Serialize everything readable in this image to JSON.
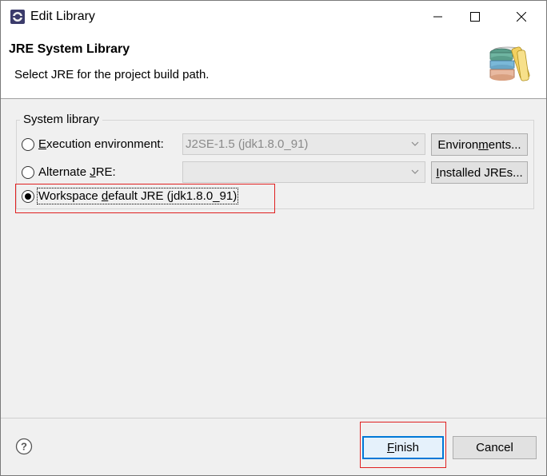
{
  "window": {
    "title": "Edit Library"
  },
  "banner": {
    "title": "JRE System Library",
    "subtitle": "Select JRE for the project build path.",
    "icon": "library-books-icon"
  },
  "group": {
    "label": "System library",
    "execution_env": {
      "label_pre": "",
      "label_mnemonic": "E",
      "label_post": "xecution environment:",
      "selected": false,
      "combo_value": "J2SE-1.5 (jdk1.8.0_91)",
      "button_label_pre": "Environ",
      "button_label_mnemonic": "m",
      "button_label_post": "ents..."
    },
    "alternate_jre": {
      "label_pre": "Alternate ",
      "label_mnemonic": "J",
      "label_post": "RE:",
      "selected": false,
      "combo_value": "",
      "button_label_pre": "",
      "button_label_mnemonic": "I",
      "button_label_post": "nstalled JREs..."
    },
    "workspace_default": {
      "label_pre": "Workspace ",
      "label_mnemonic": "d",
      "label_post": "efault JRE (jdk1.8.0_91)",
      "selected": true
    }
  },
  "footer": {
    "help_icon": "help-icon",
    "finish_pre": "",
    "finish_mnemonic": "F",
    "finish_post": "inish",
    "cancel": "Cancel"
  },
  "colors": {
    "highlight_box": "#e02020",
    "default_button_border": "#0078d7"
  }
}
